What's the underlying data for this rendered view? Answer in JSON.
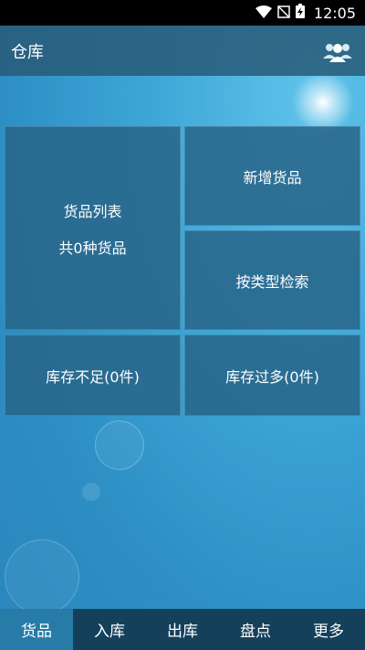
{
  "status": {
    "time": "12:05"
  },
  "header": {
    "title": "仓库",
    "icon": "users-icon"
  },
  "tiles": {
    "list_title": "货品列表",
    "list_count": "共0种货品",
    "add": "新增货品",
    "search_by_type": "按类型检索",
    "low_stock": "库存不足(0件)",
    "over_stock": "库存过多(0件)"
  },
  "nav": [
    {
      "label": "货品",
      "active": true
    },
    {
      "label": "入库"
    },
    {
      "label": "出库"
    },
    {
      "label": "盘点"
    },
    {
      "label": "更多"
    }
  ]
}
